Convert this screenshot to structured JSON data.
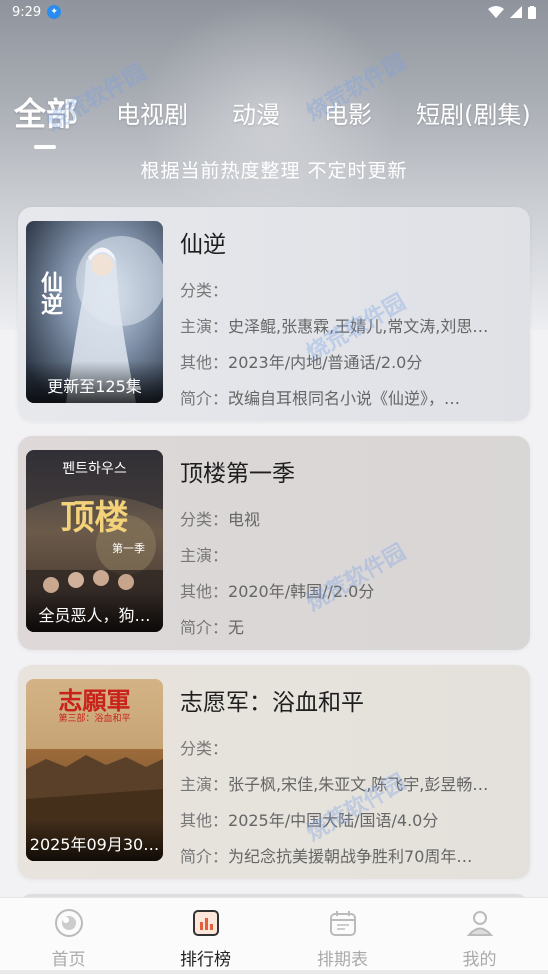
{
  "status": {
    "time": "9:29"
  },
  "tabs": [
    {
      "label": "全部",
      "active": true
    },
    {
      "label": "电视剧"
    },
    {
      "label": "动漫"
    },
    {
      "label": "电影"
    },
    {
      "label": "短剧(剧集)"
    }
  ],
  "subtitle": "根据当前热度整理 不定时更新",
  "cards": [
    {
      "title": "仙逆",
      "poster_caption": "更新至125集",
      "category_label": "分类：",
      "category": "",
      "cast_label": "主演：",
      "cast": "史泽鲲,张惠霖,王婧儿,常文涛,刘思…",
      "other_label": "其他：",
      "other": "2023年/内地/普通话/2.0分",
      "intro_label": "简介：",
      "intro": "改编自耳根同名小说《仙逆》，…"
    },
    {
      "title": "顶楼第一季",
      "poster_caption": "全员恶人，狗…",
      "category_label": "分类：",
      "category": "电视",
      "cast_label": "主演：",
      "cast": "",
      "other_label": "其他：",
      "other": "2020年/韩国//2.0分",
      "intro_label": "简介：",
      "intro": "无"
    },
    {
      "title": "志愿军：浴血和平",
      "poster_caption": "2025年09月30…",
      "category_label": "分类：",
      "category": "",
      "cast_label": "主演：",
      "cast": "张子枫,宋佳,朱亚文,陈飞宇,彭昱畅…",
      "other_label": "其他：",
      "other": "2025年/中国大陆/国语/4.0分",
      "intro_label": "简介：",
      "intro": "为纪念抗美援朝战争胜利70周年…"
    }
  ],
  "poster_text": {
    "p1": "仙逆",
    "p2_top": "펜트하우스",
    "p2_main": "顶楼",
    "p2_sub": "第一季",
    "p3_main": "志願軍",
    "p3_sub": "第三部：浴血和平"
  },
  "nav": [
    {
      "label": "首页",
      "icon": "home-icon"
    },
    {
      "label": "排行榜",
      "icon": "ranking-icon",
      "active": true
    },
    {
      "label": "排期表",
      "icon": "calendar-icon"
    },
    {
      "label": "我的",
      "icon": "profile-icon"
    }
  ],
  "watermark": "烧荒软件园",
  "colors": {
    "tab_active": "#ffffff",
    "nav_active": "#222222",
    "nav_inactive": "#aaaaaa",
    "accent": "#e2603a"
  }
}
